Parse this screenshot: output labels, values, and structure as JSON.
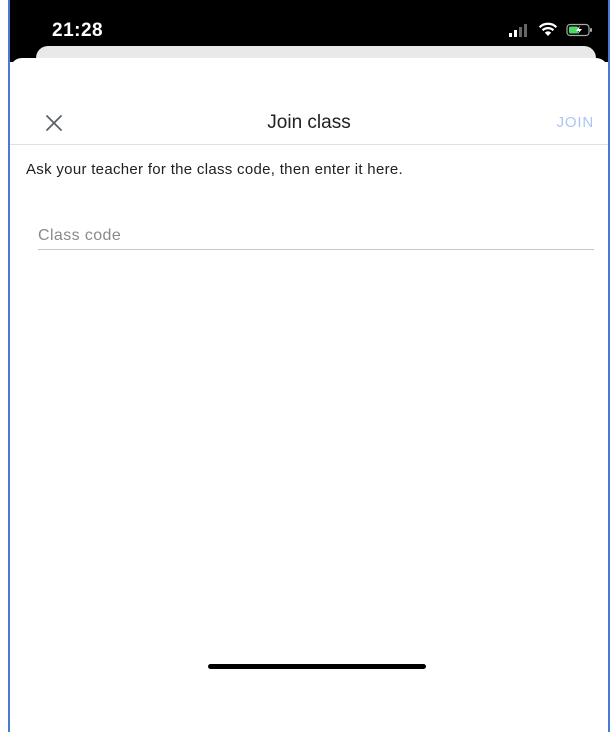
{
  "status_bar": {
    "time": "21:28",
    "icons": [
      "cellular-signal-icon",
      "wifi-icon",
      "battery-charging-icon"
    ],
    "background": "#000000"
  },
  "header": {
    "close_icon": "close-icon",
    "title": "Join class",
    "join_label": "JOIN",
    "join_color": "#a9c8f2"
  },
  "main": {
    "instructions": "Ask your teacher for the class code, then enter it here.",
    "class_code": {
      "value": "",
      "placeholder": "Class code"
    }
  }
}
